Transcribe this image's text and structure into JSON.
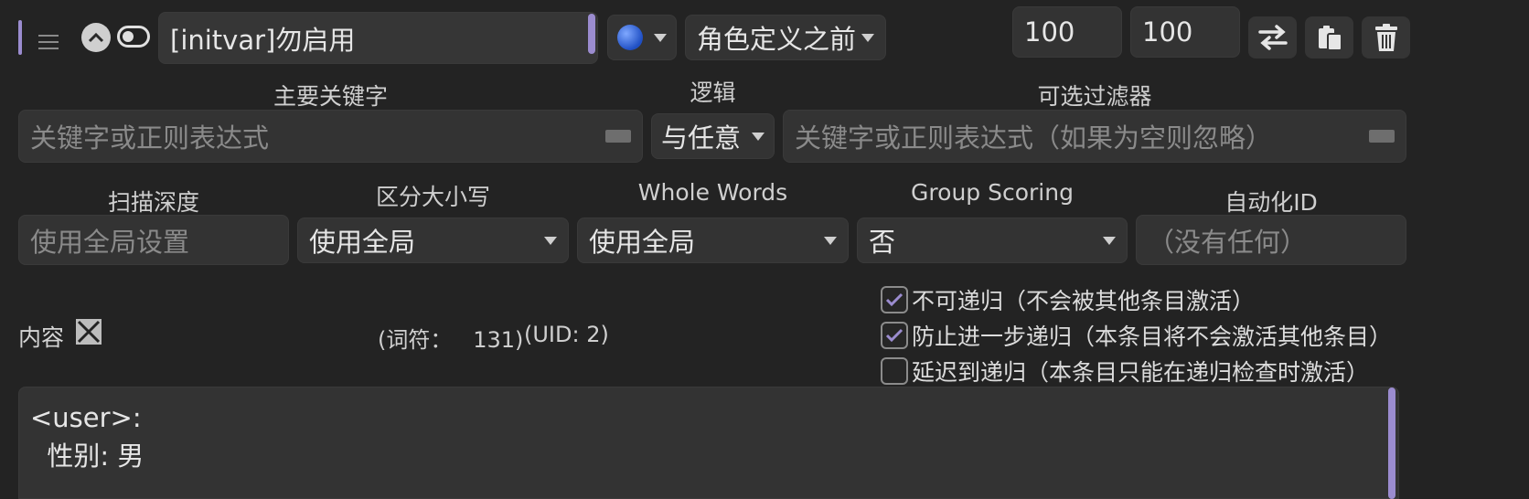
{
  "entry": {
    "title": "[initvar]勿启用",
    "position": "角色定义之前",
    "order": "100",
    "probability": "100"
  },
  "labels": {
    "primary_keywords": "主要关键字",
    "logic": "逻辑",
    "optional_filter": "可选过滤器",
    "scan_depth": "扫描深度",
    "case_sensitive": "区分大小写",
    "whole_words": "Whole Words",
    "group_scoring": "Group Scoring",
    "automation_id": "自动化ID",
    "content": "内容"
  },
  "fields": {
    "primary_keywords_placeholder": "关键字或正则表达式",
    "logic_value": "与任意",
    "optional_filter_placeholder": "关键字或正则表达式（如果为空则忽略）",
    "scan_depth_placeholder": "使用全局设置",
    "case_sensitive_value": "使用全局",
    "whole_words_value": "使用全局",
    "group_scoring_value": "否",
    "automation_id_placeholder": "（没有任何）"
  },
  "stats": {
    "tokens_text": "(词符：   131)",
    "uid_text": "(UID: 2)"
  },
  "checkboxes": [
    {
      "label": "不可递归（不会被其他条目激活）",
      "checked": true
    },
    {
      "label": "防止进一步递归（本条目将不会激活其他条目）",
      "checked": true
    },
    {
      "label": "延迟到递归（本条目只能在递归检查时激活）",
      "checked": false
    }
  ],
  "content": {
    "line1": "<user>:",
    "line2": "  性别: 男"
  },
  "colors": {
    "accent": "#9b8ccf",
    "background": "#232323",
    "field": "#333333"
  },
  "icons": {
    "drag": "drag-handle-icon",
    "collapse": "chevron-up-icon",
    "toggle": "toggle-icon",
    "status": "blue-circle-icon",
    "move": "swap-arrows-icon",
    "copy": "clipboard-icon",
    "delete": "trash-icon",
    "expand": "expand-arrows-icon",
    "keyboard": "keyboard-icon"
  }
}
